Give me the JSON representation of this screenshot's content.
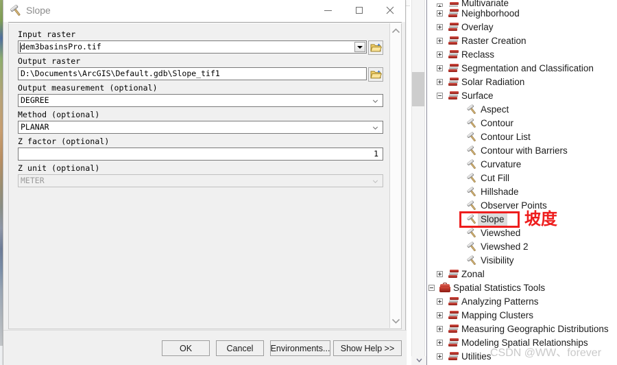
{
  "dialog": {
    "title": "Slope",
    "title_icon": "hammer-icon",
    "window_buttons": {
      "minimize": "–",
      "maximize": "□",
      "close": "✕"
    },
    "fields": [
      {
        "label": "Input raster",
        "value": "dem3basinsPro.tif",
        "control": "combobox",
        "browse": true,
        "disabled": false
      },
      {
        "label": "Output raster",
        "value": "D:\\Documents\\ArcGIS\\Default.gdb\\Slope_tif1",
        "control": "text",
        "browse": true,
        "disabled": false
      },
      {
        "label": "Output measurement (optional)",
        "value": "DEGREE",
        "control": "dropdown",
        "browse": false,
        "disabled": false
      },
      {
        "label": "Method (optional)",
        "value": "PLANAR",
        "control": "dropdown",
        "browse": false,
        "disabled": false
      },
      {
        "label": "Z factor (optional)",
        "value": "1",
        "control": "number",
        "browse": false,
        "disabled": false
      },
      {
        "label": "Z unit (optional)",
        "value": "METER",
        "control": "dropdown",
        "browse": false,
        "disabled": true
      }
    ],
    "buttons": {
      "ok": "OK",
      "cancel": "Cancel",
      "environments": "Environments...",
      "help": "Show Help >>"
    }
  },
  "tree": {
    "items": [
      {
        "label": "Multivariate",
        "level": 1,
        "icon": "toolset-icon",
        "expander": "plus",
        "partial": true
      },
      {
        "label": "Neighborhood",
        "level": 1,
        "icon": "toolset-icon",
        "expander": "plus"
      },
      {
        "label": "Overlay",
        "level": 1,
        "icon": "toolset-icon",
        "expander": "plus"
      },
      {
        "label": "Raster Creation",
        "level": 1,
        "icon": "toolset-icon",
        "expander": "plus"
      },
      {
        "label": "Reclass",
        "level": 1,
        "icon": "toolset-icon",
        "expander": "plus"
      },
      {
        "label": "Segmentation and Classification",
        "level": 1,
        "icon": "toolset-icon",
        "expander": "plus"
      },
      {
        "label": "Solar Radiation",
        "level": 1,
        "icon": "toolset-icon",
        "expander": "plus"
      },
      {
        "label": "Surface",
        "level": 1,
        "icon": "toolset-icon",
        "expander": "minus"
      },
      {
        "label": "Aspect",
        "level": 2,
        "icon": "hammer-icon",
        "expander": "none"
      },
      {
        "label": "Contour",
        "level": 2,
        "icon": "hammer-icon",
        "expander": "none"
      },
      {
        "label": "Contour List",
        "level": 2,
        "icon": "hammer-icon",
        "expander": "none"
      },
      {
        "label": "Contour with Barriers",
        "level": 2,
        "icon": "hammer-icon",
        "expander": "none"
      },
      {
        "label": "Curvature",
        "level": 2,
        "icon": "hammer-icon",
        "expander": "none"
      },
      {
        "label": "Cut Fill",
        "level": 2,
        "icon": "hammer-icon",
        "expander": "none"
      },
      {
        "label": "Hillshade",
        "level": 2,
        "icon": "hammer-icon",
        "expander": "none"
      },
      {
        "label": "Observer Points",
        "level": 2,
        "icon": "hammer-icon",
        "expander": "none"
      },
      {
        "label": "Slope",
        "level": 2,
        "icon": "hammer-icon",
        "expander": "none",
        "selected": true,
        "highlighted": true
      },
      {
        "label": "Viewshed",
        "level": 2,
        "icon": "hammer-icon",
        "expander": "none"
      },
      {
        "label": "Viewshed 2",
        "level": 2,
        "icon": "hammer-icon",
        "expander": "none"
      },
      {
        "label": "Visibility",
        "level": 2,
        "icon": "hammer-icon",
        "expander": "none"
      },
      {
        "label": "Zonal",
        "level": 1,
        "icon": "toolset-icon",
        "expander": "plus"
      },
      {
        "label": "Spatial Statistics Tools",
        "level": 0,
        "icon": "toolbox-icon",
        "expander": "minus"
      },
      {
        "label": "Analyzing Patterns",
        "level": 1,
        "icon": "toolset-icon",
        "expander": "plus"
      },
      {
        "label": "Mapping Clusters",
        "level": 1,
        "icon": "toolset-icon",
        "expander": "plus"
      },
      {
        "label": "Measuring Geographic Distributions",
        "level": 1,
        "icon": "toolset-icon",
        "expander": "plus"
      },
      {
        "label": "Modeling Spatial Relationships",
        "level": 1,
        "icon": "toolset-icon",
        "expander": "plus"
      },
      {
        "label": "Utilities",
        "level": 1,
        "icon": "toolset-icon",
        "expander": "plus"
      }
    ]
  },
  "annotation": {
    "chinese_label": "坡度",
    "box_color": "#ee1d1d"
  },
  "watermark": {
    "text": "CSDN @WW、forever"
  }
}
